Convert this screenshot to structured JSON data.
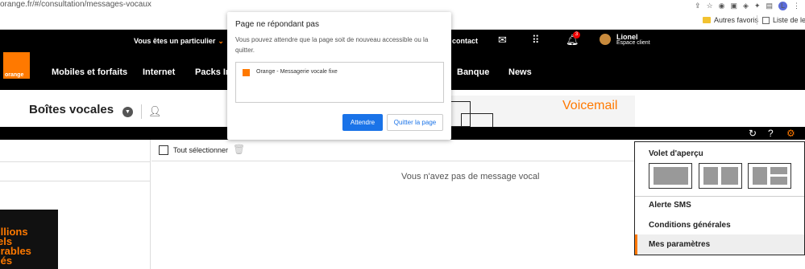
{
  "browser": {
    "url": "orange.fr/#/consultation/messages-vocaux",
    "bookmarks": [
      {
        "label": "Autres favoris"
      },
      {
        "label": "Liste de lec"
      }
    ],
    "avatar_letter": "L"
  },
  "header": {
    "top_link": "Vous êtes un particulier",
    "contact_label": "contact",
    "notification_count": "3",
    "user_name": "Lionel",
    "user_sub": "Espace client",
    "logo_text": "orange",
    "nav": [
      "Mobiles et forfaits",
      "Internet",
      "Packs In",
      "Banque",
      "News"
    ]
  },
  "page": {
    "title": "Boîtes vocales",
    "banner_text": "Voicemail"
  },
  "content": {
    "select_all_label": "Tout sélectionner",
    "empty_message": "Vous n'avez pas de message vocal",
    "promo_lines": [
      "illions",
      "els",
      "irables",
      "ıés"
    ]
  },
  "menu": {
    "title": "Volet d'aperçu",
    "items": [
      "Alerte SMS",
      "Conditions générales",
      "Mes paramètres"
    ]
  },
  "dialog": {
    "title": "Page ne répondant pas",
    "text": "Vous pouvez attendre que la page soit de nouveau accessible ou la quitter.",
    "tab_name": "Orange - Messagerie vocale fixe",
    "wait_label": "Attendre",
    "quit_label": "Quitter la page"
  },
  "colors": {
    "brand": "#ff7900",
    "header_bg": "#000000",
    "primary_button": "#1a73e8"
  }
}
